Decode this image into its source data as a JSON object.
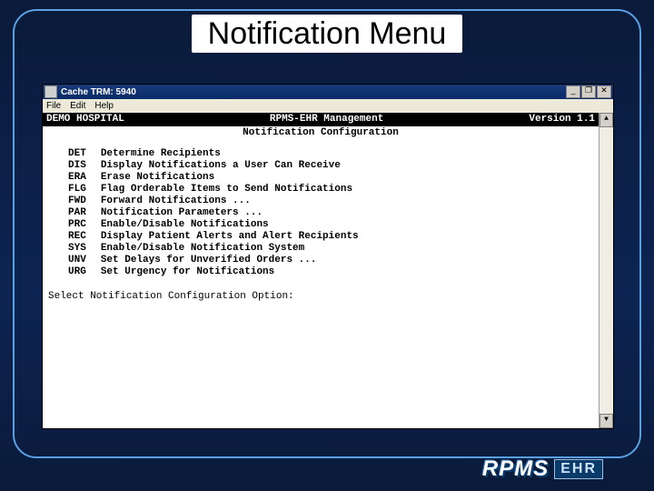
{
  "slide": {
    "title": "Notification Menu"
  },
  "window": {
    "title": "Cache TRM: 5940",
    "menubar": {
      "file": "File",
      "edit": "Edit",
      "help": "Help"
    },
    "controls": {
      "min": "_",
      "max": "❐",
      "close": "✕",
      "up": "▲",
      "down": "▼"
    }
  },
  "header": {
    "hospital": "DEMO HOSPITAL",
    "app": "RPMS-EHR Management",
    "version": "Version 1.1",
    "subtitle": "Notification Configuration"
  },
  "menu": {
    "items": [
      {
        "code": "DET",
        "desc": "Determine Recipients"
      },
      {
        "code": "DIS",
        "desc": "Display Notifications a User Can Receive"
      },
      {
        "code": "ERA",
        "desc": "Erase Notifications"
      },
      {
        "code": "FLG",
        "desc": "Flag Orderable Items to Send Notifications"
      },
      {
        "code": "FWD",
        "desc": "Forward Notifications ..."
      },
      {
        "code": "PAR",
        "desc": "Notification Parameters ..."
      },
      {
        "code": "PRC",
        "desc": "Enable/Disable Notifications"
      },
      {
        "code": "REC",
        "desc": "Display Patient Alerts and Alert Recipients"
      },
      {
        "code": "SYS",
        "desc": "Enable/Disable Notification System"
      },
      {
        "code": "UNV",
        "desc": "Set Delays for Unverified Orders ..."
      },
      {
        "code": "URG",
        "desc": "Set Urgency for Notifications"
      }
    ]
  },
  "prompt": "Select Notification Configuration Option:",
  "logo": {
    "rpms": "RPMS",
    "ehr": "EHR"
  }
}
